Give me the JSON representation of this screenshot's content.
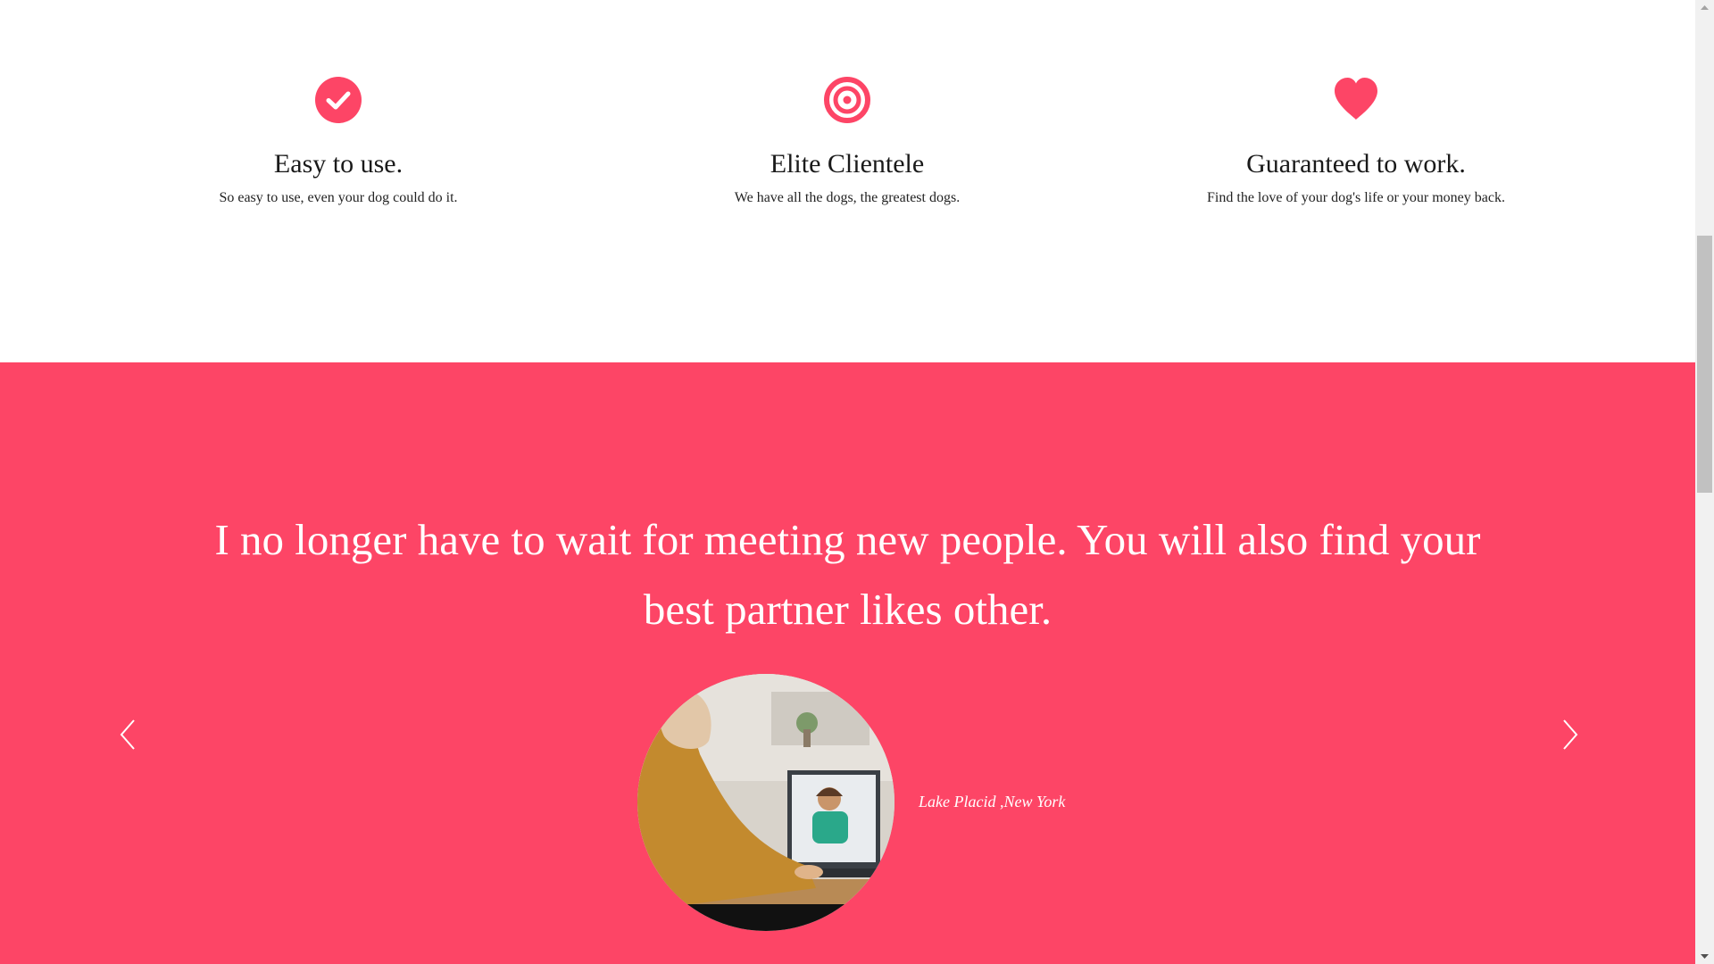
{
  "features": [
    {
      "icon": "check-circle-icon",
      "title": "Easy to use.",
      "description": "So easy to use, even your dog could do it."
    },
    {
      "icon": "target-icon",
      "title": "Elite Clientele",
      "description": "We have all the dogs, the greatest dogs."
    },
    {
      "icon": "heart-icon",
      "title": "Guaranteed to work.",
      "description": "Find the love of your dog's life or your money back."
    }
  ],
  "testimonial": {
    "quote": "I no longer have to wait for meeting new people. You will also find your best partner likes other.",
    "location": "Lake Placid ,New York",
    "prev_icon": "chevron-left-icon",
    "next_icon": "chevron-right-icon"
  },
  "colors": {
    "accent": "#fd4566",
    "text_dark": "#1a1a1a",
    "background": "#ffffff"
  }
}
